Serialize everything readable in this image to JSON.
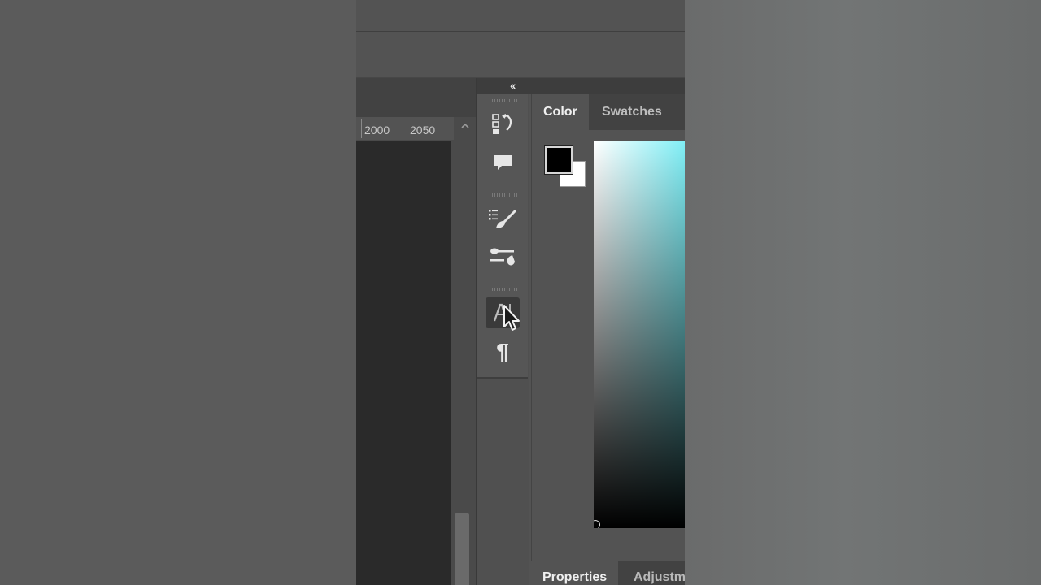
{
  "ruler": {
    "labels": [
      "2000",
      "2050"
    ]
  },
  "panel": {
    "collapse_label": "‹‹",
    "tabs": [
      {
        "label": "Color"
      },
      {
        "label": "Swatches"
      }
    ],
    "foreground_color": "#000000",
    "background_color": "#ffffff",
    "picker_hue_color": "#7feff6"
  },
  "bottom_panel": {
    "tabs": [
      {
        "label": "Properties"
      },
      {
        "label": "Adjustm"
      }
    ]
  },
  "icon_strip": {
    "groups": [
      {
        "icons": [
          "history-icon",
          "comments-icon"
        ]
      },
      {
        "icons": [
          "brush-settings-icon",
          "brushes-icon"
        ]
      },
      {
        "icons": [
          "character-icon",
          "paragraph-icon"
        ]
      }
    ],
    "paragraph_glyph": "¶"
  }
}
